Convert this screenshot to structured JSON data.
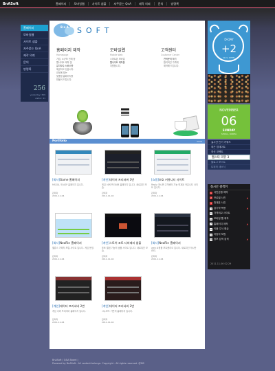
{
  "top": {
    "brand": "BnASoft",
    "nav": [
      "홈페이지",
      "모바일웹",
      "사이트 샘플",
      "자주묻는 QnA",
      "제작 의뢰",
      "문의",
      "방명록"
    ]
  },
  "left": {
    "items": [
      "홈페이지",
      "모바일웹",
      "사이트 샘플",
      "자주묻는 QnA",
      "제작 의뢰",
      "문의",
      "방명록"
    ],
    "counter": "256",
    "yesterday": "yesterday: 369",
    "visitor": "visitor: 41"
  },
  "logo": {
    "prefix": "B n A",
    "name": "SOFT"
  },
  "services": [
    {
      "title": "홈페이지 제작",
      "sub": "Homepage",
      "lines": [
        "기업, 소규모 단체 등",
        "웹사이트 제작 및",
        "유지보수 서비스를",
        "제공하고 있습니다.",
        "요청에 맞는",
        "맞춤형 홈페이지를",
        "만들어 드립니다."
      ]
    },
    {
      "title": "모바일웹",
      "sub": "Mobile Web",
      "lines": [
        "스마트폰 모바일",
        "웹사이트 제작을",
        "지원합니다."
      ]
    },
    {
      "title": "고객센터",
      "sub": "Customer Center",
      "lines": [
        "견적문의 하기",
        "합리적인 가격에",
        "제작해 드립니다."
      ],
      "more_label": "문의하기",
      "more_val": "010.0000.0000"
    }
  ],
  "portfolio": {
    "title": "Portfolio",
    "more": "more",
    "items": [
      {
        "badge": "[회사]",
        "name": "Game 홈페이지",
        "desc": "MSSQL 와 ASP 홈페이지 입니다.",
        "author": "관리자",
        "date": "2011-11-04"
      },
      {
        "badge": "[개인]",
        "name": "데이터 프리서버 3번",
        "desc": "게임 서버 프리서버 홈페이지 입니다. 새로워진 모습.",
        "author": "관리자",
        "date": "2011-11-04"
      },
      {
        "badge": "[쇼핑]",
        "name": "보호 커뮤니티 사이트",
        "desc": "Reply 게시판 고객센터 기능 연계된 커뮤니티 사이트 입니다.",
        "author": "관리자",
        "date": "2011-11-04"
      },
      {
        "badge": "[회사]",
        "name": "NeoRin 홈페이지",
        "desc": "밸류스 거래처 포털 사이트 입니다. 게임 운영.",
        "author": "관리자",
        "date": "2011-11-04"
      },
      {
        "badge": "[개인]",
        "name": "스토어 포토 디비테리 샘플",
        "desc": "포토 앨범 기능의 샘플 사이트 입니다. 새로워진 모습.",
        "author": "관리자",
        "date": "2011-11-04"
      },
      {
        "badge": "[회사]",
        "name": "NeoRin 홈페이지",
        "desc": "web 쇼핑몰 포트폴리오 입니다. 새로워진 게시판 관리.",
        "author": "관리자",
        "date": "2011-11-04"
      },
      {
        "badge": "[개인]",
        "name": "데이터 프리서버 2번",
        "desc": "게임 서버 프리서버 홈페이지 입니다.",
        "author": "관리자",
        "date": "2011-11-04"
      },
      {
        "badge": "[개인]",
        "name": "데이터 프리서버 2번",
        "desc": "그누보드 기반의 홈페이지 입니다.",
        "author": "관리자",
        "date": "2011-11-04"
      }
    ]
  },
  "clock": {
    "dday": "D-DAY",
    "value": "+2",
    "since": "Since OPEN."
  },
  "date": {
    "month": "NOVEMBER",
    "day": "06",
    "dow": "SUNDAY",
    "loc": "SEOUL, KOREA"
  },
  "right_tabs": [
    "실시간 인기 키워드",
    "최근 업데이트",
    "최신 코멘트",
    "웹스타 리뷰 3",
    "블로그 포스트",
    "트위터 새소식"
  ],
  "live": {
    "title": "실시간 검색어",
    "items": [
      "국민은행 예약",
      "프로필 사진",
      "휴대폰 사진",
      "감기약 복용",
      "가격비교 사이트",
      "모바일 웹 제작",
      "홈페이지 제작",
      "키움 주식 예금",
      "자동차 보험",
      "정보 검색 검색"
    ],
    "changes": [
      "",
      "▲",
      "",
      "▲",
      "",
      "",
      "▲",
      "",
      "",
      "▲"
    ],
    "ts": "2011.11.06 02:29"
  },
  "footer": {
    "line1": "BnASoft  |  Q&A  Board  |",
    "line2": "Powered by BnASoft - All content belongs. Copyright . All rights reserved. @MS"
  }
}
